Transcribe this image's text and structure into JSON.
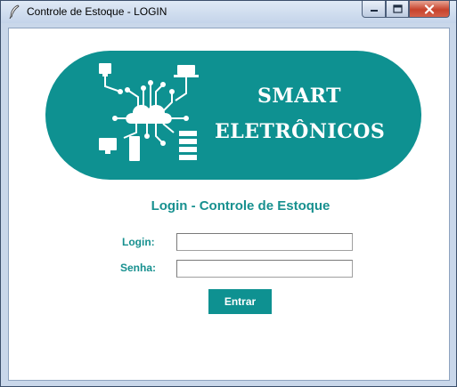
{
  "window": {
    "title": "Controle de Estoque - LOGIN",
    "app_icon": "feather-icon",
    "controls": [
      "minimize-icon",
      "maximize-icon",
      "close-icon"
    ]
  },
  "banner": {
    "brand_line1": "SMART",
    "brand_line2": "ELETRÔNICOS",
    "graphic": "circuit-cloud-devices-icon",
    "color": "#0e9191"
  },
  "form": {
    "heading": "Login - Controle de Estoque",
    "login_label": "Login:",
    "login_value": "",
    "password_label": "Senha:",
    "password_value": "",
    "submit_label": "Entrar"
  },
  "colors": {
    "accent": "#0e9191",
    "label_text": "#17908f"
  }
}
